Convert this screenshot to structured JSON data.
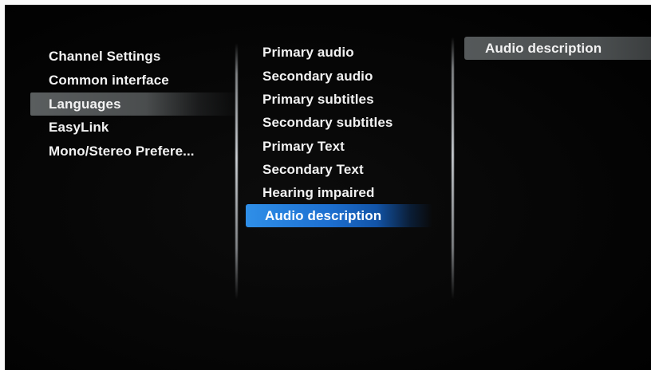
{
  "settings_menu": {
    "items": [
      {
        "label": "Channel Settings"
      },
      {
        "label": "Common interface"
      },
      {
        "label": "Languages"
      },
      {
        "label": "EasyLink"
      },
      {
        "label": "Mono/Stereo Prefere..."
      }
    ],
    "active_item": "Languages"
  },
  "languages_menu": {
    "items": [
      {
        "label": "Primary audio"
      },
      {
        "label": "Secondary audio"
      },
      {
        "label": "Primary subtitles"
      },
      {
        "label": "Secondary subtitles"
      },
      {
        "label": "Primary Text"
      },
      {
        "label": "Secondary Text"
      },
      {
        "label": "Hearing impaired"
      },
      {
        "label": "Audio description"
      }
    ],
    "selected_item": "Audio description"
  },
  "detail_panel": {
    "items": [
      {
        "label": "Audio description"
      }
    ]
  },
  "colors": {
    "background": "#000000",
    "text": "#f2f2f2",
    "selection_blue": "#1d6fd0",
    "active_grey": "#55595a"
  }
}
